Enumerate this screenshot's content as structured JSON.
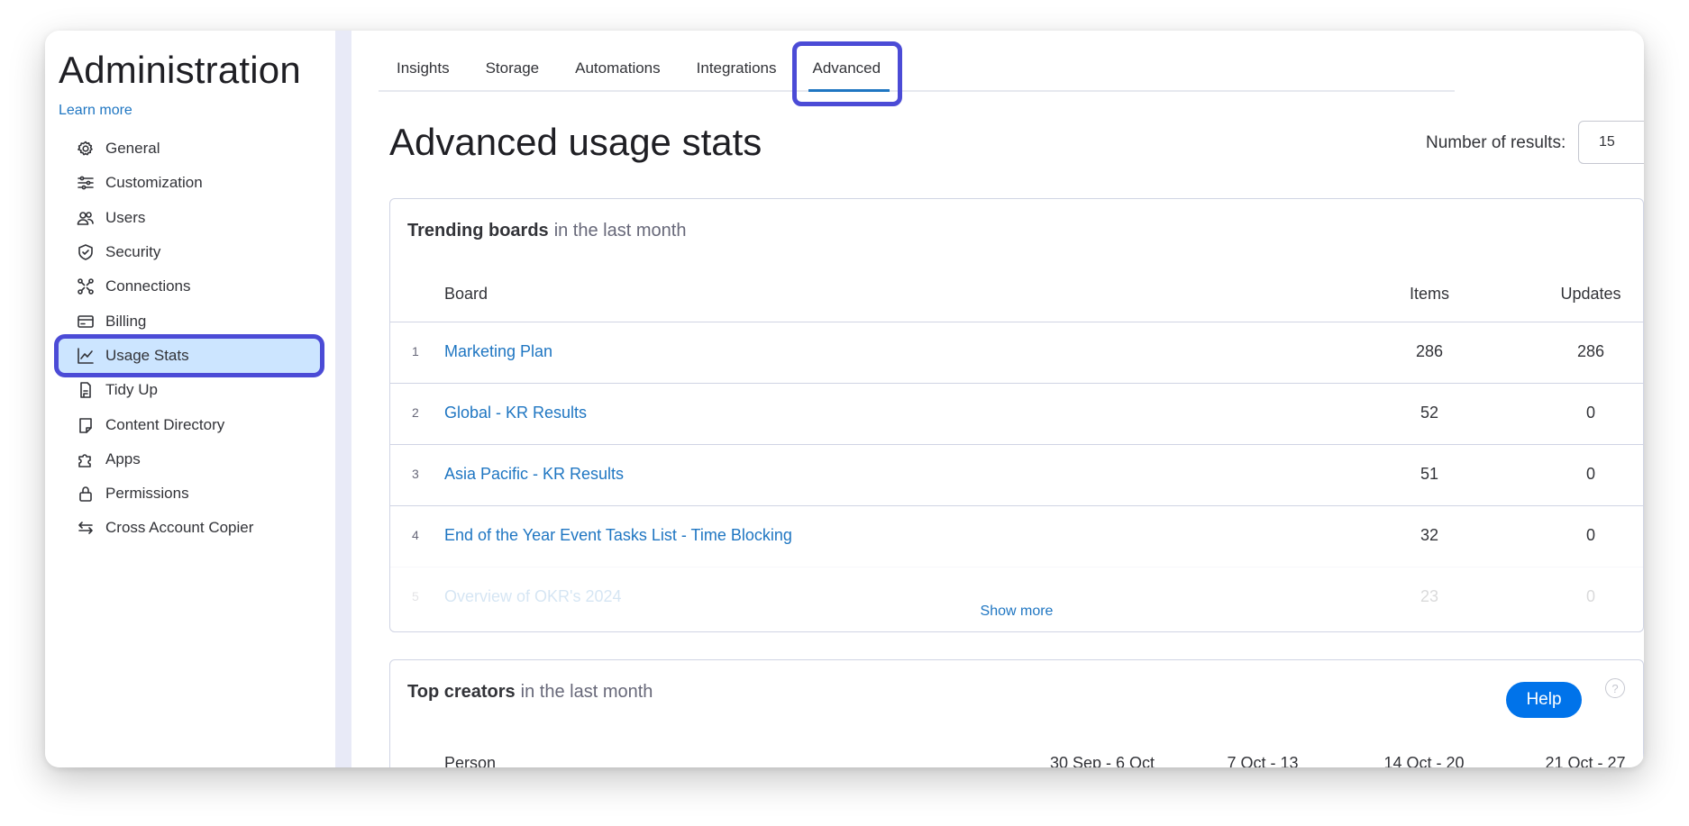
{
  "sidebar": {
    "title": "Administration",
    "learn_more": "Learn more",
    "items": [
      {
        "label": "General",
        "icon": "gear-icon"
      },
      {
        "label": "Customization",
        "icon": "sliders-icon"
      },
      {
        "label": "Users",
        "icon": "users-icon"
      },
      {
        "label": "Security",
        "icon": "shield-icon"
      },
      {
        "label": "Connections",
        "icon": "connections-icon"
      },
      {
        "label": "Billing",
        "icon": "credit-card-icon"
      },
      {
        "label": "Usage Stats",
        "icon": "chart-line-icon",
        "active": true
      },
      {
        "label": "Tidy Up",
        "icon": "broom-icon"
      },
      {
        "label": "Content Directory",
        "icon": "document-icon"
      },
      {
        "label": "Apps",
        "icon": "puzzle-icon"
      },
      {
        "label": "Permissions",
        "icon": "lock-icon"
      },
      {
        "label": "Cross Account Copier",
        "icon": "swap-icon"
      }
    ]
  },
  "tabs": [
    {
      "label": "Insights"
    },
    {
      "label": "Storage"
    },
    {
      "label": "Automations"
    },
    {
      "label": "Integrations"
    },
    {
      "label": "Advanced",
      "active": true
    }
  ],
  "page": {
    "title": "Advanced usage stats",
    "results_label": "Number of results:",
    "results_value": "15"
  },
  "trending": {
    "title": "Trending boards",
    "subtitle": "in the last month",
    "columns": {
      "board": "Board",
      "items": "Items",
      "updates": "Updates"
    },
    "rows": [
      {
        "rank": "1",
        "name": "Marketing Plan",
        "items": "286",
        "updates": "286"
      },
      {
        "rank": "2",
        "name": "Global - KR Results",
        "items": "52",
        "updates": "0"
      },
      {
        "rank": "3",
        "name": "Asia Pacific - KR Results",
        "items": "51",
        "updates": "0"
      },
      {
        "rank": "4",
        "name": "End of the Year Event Tasks List - Time Blocking",
        "items": "32",
        "updates": "0"
      },
      {
        "rank": "5",
        "name": "Overview of OKR's 2024",
        "items": "23",
        "updates": "0"
      }
    ],
    "show_more": "Show more"
  },
  "creators": {
    "title": "Top creators",
    "subtitle": "in the last month",
    "columns": {
      "person": "Person",
      "w1": "30 Sep - 6 Oct",
      "w2": "7 Oct - 13",
      "w3": "14 Oct - 20",
      "w4": "21 Oct - 27"
    }
  },
  "help": {
    "label": "Help"
  },
  "colors": {
    "accent": "#1f76c2",
    "highlight": "#4b4bd6",
    "active_bg": "#cce5ff",
    "help_bg": "#0073ea"
  }
}
